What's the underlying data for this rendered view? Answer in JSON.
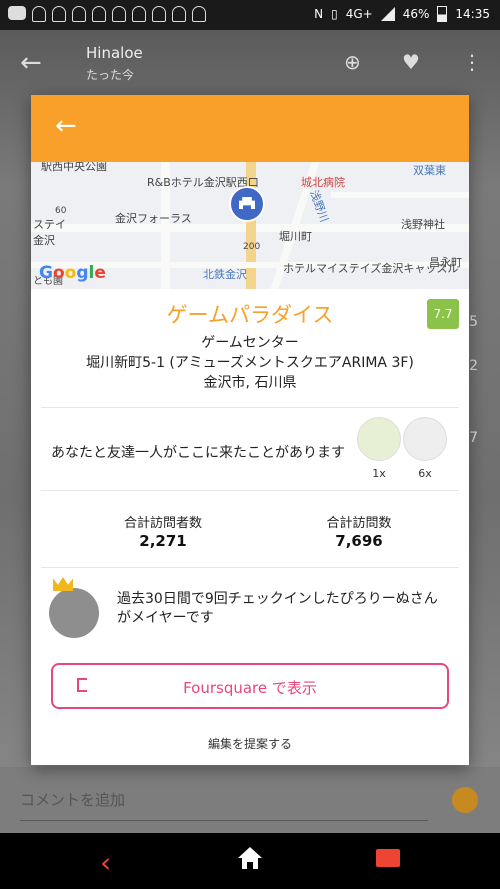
{
  "status_bar": {
    "network": "4G+",
    "battery": "46%",
    "time": "14:35"
  },
  "background": {
    "title": "Hinaloe",
    "subtitle": "たった今",
    "comment_placeholder": "コメントを追加",
    "numbers": [
      "5",
      "2",
      "7"
    ]
  },
  "map": {
    "labels": [
      "駅西中央公園",
      "R&Bホテル金沢駅西口",
      "城北病院",
      "双葉東",
      "金沢フォーラス",
      "浅野神社",
      "堀川町",
      "北鉄金沢",
      "ホテルマイステイズ金沢キャッスル",
      "昌永町",
      "ステイ",
      "金沢",
      "浅野川",
      "200",
      "60",
      "とも園"
    ],
    "brand": [
      "G",
      "o",
      "o",
      "g",
      "l",
      "e"
    ]
  },
  "venue": {
    "name": "ゲームパラダイス",
    "score": "7.7",
    "category": "ゲームセンター",
    "address_line1": "堀川新町5-1 (アミューズメントスクエアARIMA 3F)",
    "address_line2": "金沢市, 石川県"
  },
  "friends": {
    "text": "あなたと友達一人がここに来たことがあります",
    "counts": [
      "1x",
      "6x"
    ]
  },
  "stats": {
    "visitors_label": "合計訪問者数",
    "visitors_value": "2,271",
    "visits_label": "合計訪問数",
    "visits_value": "7,696"
  },
  "mayor": {
    "text": "過去30日間で9回チェックインしたぴろりーぬさんがメイヤーです"
  },
  "actions": {
    "foursquare": "Foursquare で表示",
    "suggest_edit": "編集を提案する"
  },
  "colors": {
    "accent": "#f8a02a",
    "pink": "#e8477e",
    "score": "#8bc34a"
  }
}
